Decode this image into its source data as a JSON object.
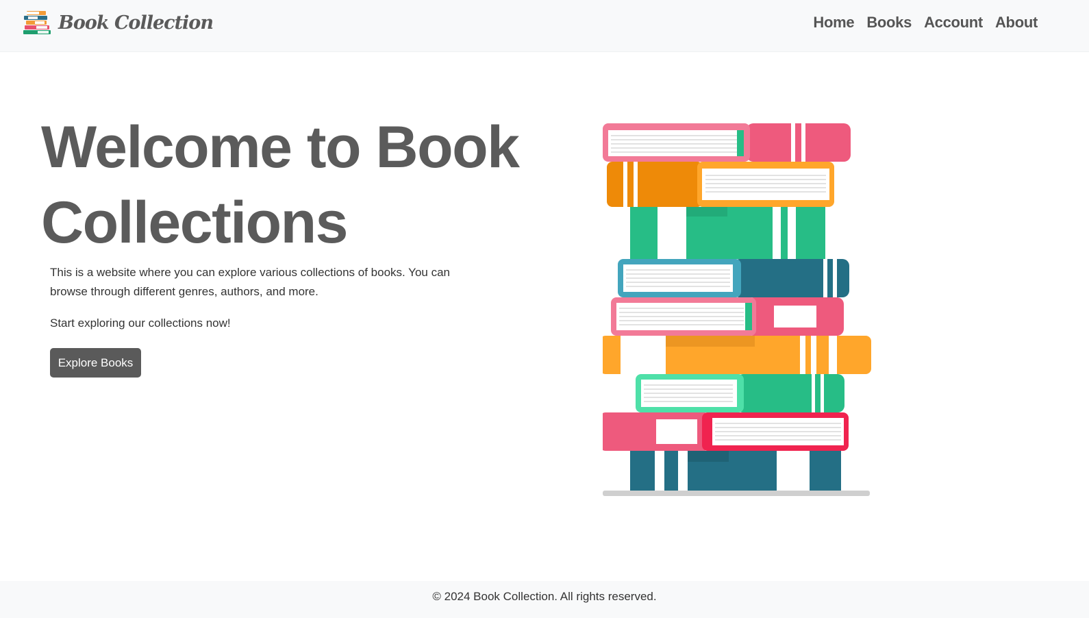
{
  "nav": {
    "brand": "Book Collection",
    "links": [
      "Home",
      "Books",
      "Account",
      "About"
    ]
  },
  "hero": {
    "title": "Welcome to Book Collections",
    "description": "This is a website where you can explore various collections of books. You can browse through different genres, authors, and more.",
    "cta_text": "Start exploring our collections now!",
    "button_label": "Explore Books"
  },
  "footer": {
    "text": "© 2024 Book Collection. All rights reserved."
  },
  "colors": {
    "nav_bg": "#f8f9fa",
    "text_dark": "#5b5b5b",
    "button_bg": "#5a5a5a",
    "book_pink": "#ee5a7d",
    "book_orange": "#ffa62b",
    "book_green": "#27bd86",
    "book_teal": "#246f85"
  },
  "icons": {
    "brand_logo": "book-stack-icon",
    "hero_image": "book-stack-illustration"
  }
}
